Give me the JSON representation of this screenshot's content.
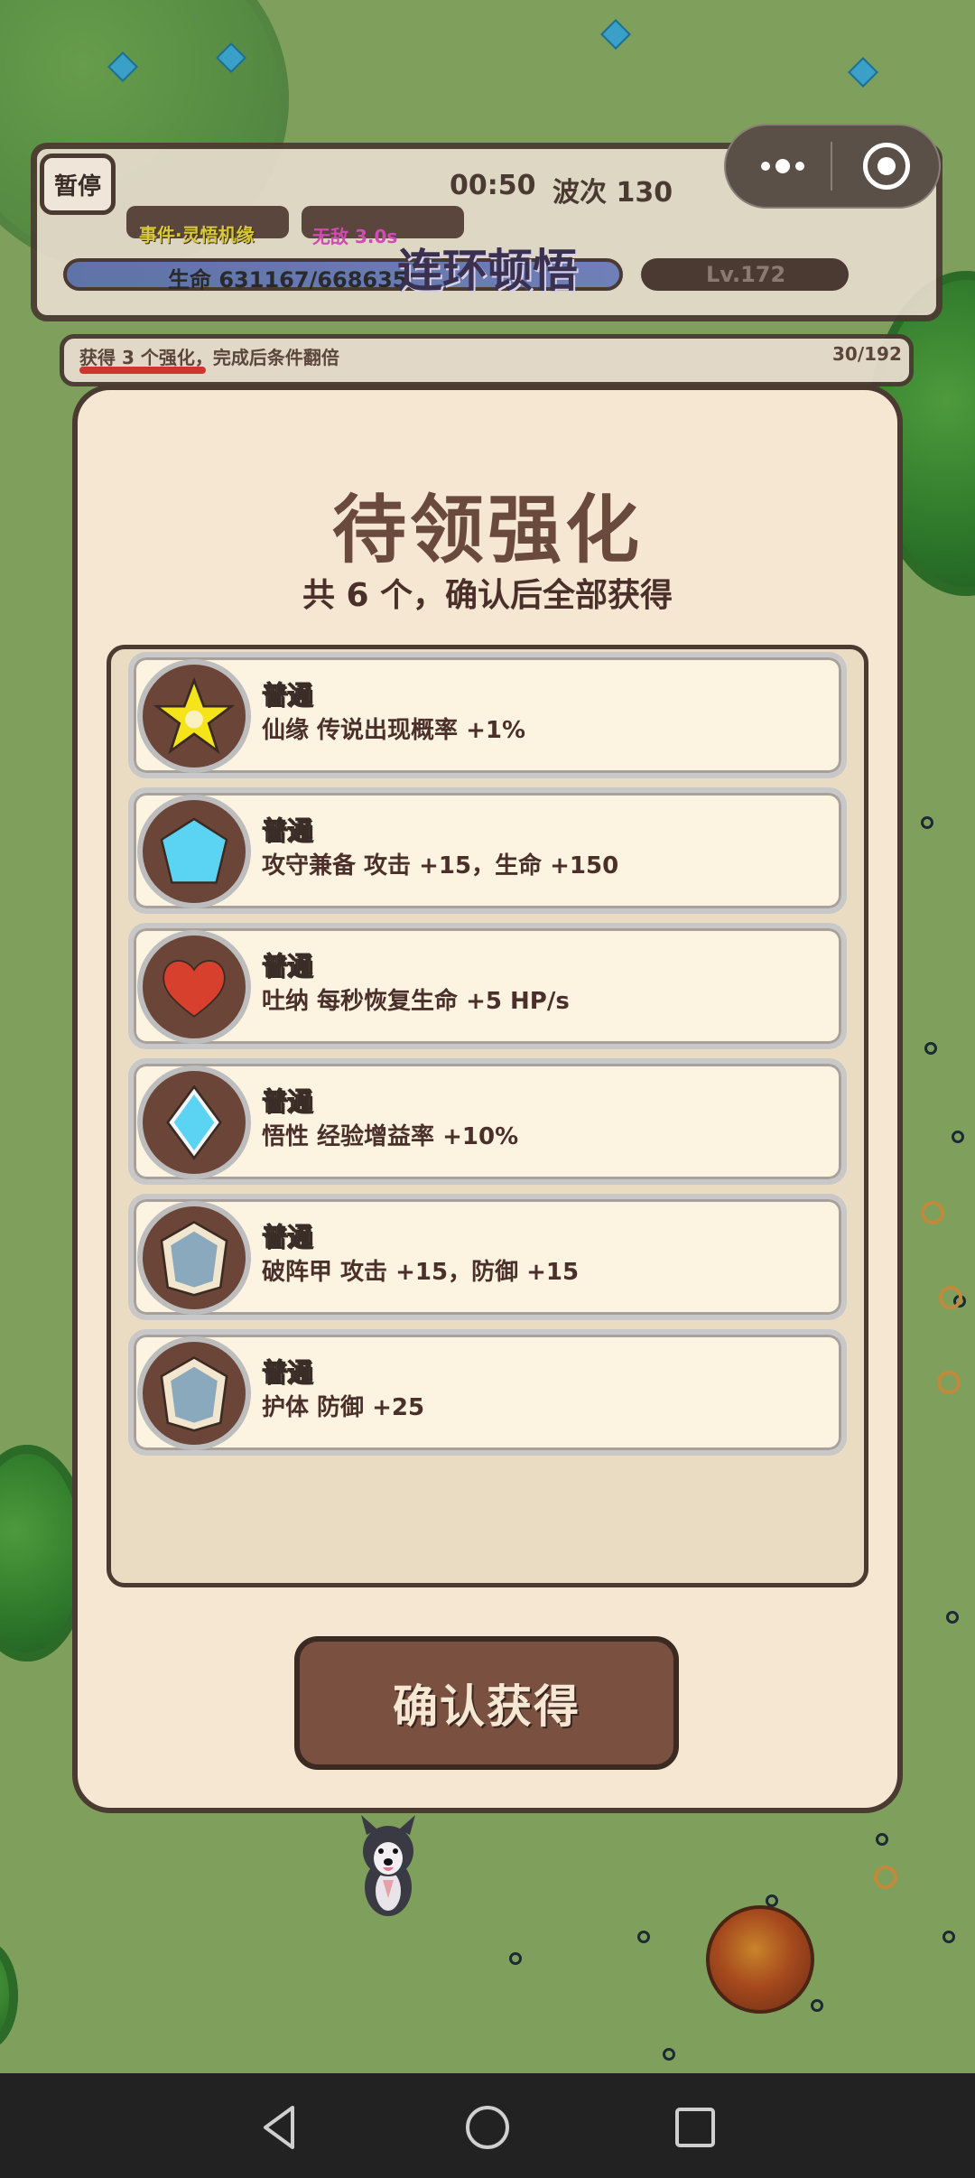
{
  "hud": {
    "pause_label": "暂停",
    "timer": "00:50",
    "wave": "波次 130",
    "event": "事件·灵悟机缘",
    "invincible": "无敌 3.0s",
    "hp": "生命 631167/668635",
    "combo": "连环顿悟",
    "level": "Lv.172"
  },
  "quest": {
    "text": "获得 3 个强化，完成后条件翻倍",
    "count": "30/192"
  },
  "modal": {
    "title": "待领强化",
    "subtitle": "共 6 个，确认后全部获得",
    "confirm_label": "确认获得",
    "rewards": [
      {
        "rarity": "普通",
        "desc": "仙缘  传说出现概率 +1%",
        "icon": "star-icon"
      },
      {
        "rarity": "普通",
        "desc": "攻守兼备  攻击 +15，生命 +150",
        "icon": "crystal-pentagon-icon"
      },
      {
        "rarity": "普通",
        "desc": "吐纳  每秒恢复生命 +5 HP/s",
        "icon": "heart-icon"
      },
      {
        "rarity": "普通",
        "desc": "悟性  经验增益率 +10%",
        "icon": "diamond-icon"
      },
      {
        "rarity": "普通",
        "desc": "破阵甲  攻击 +15，防御 +15",
        "icon": "shield-icon"
      },
      {
        "rarity": "普通",
        "desc": "护体  防御 +25",
        "icon": "shield-icon"
      }
    ]
  },
  "colors": {
    "panel_bg": "#f6e7d3",
    "border": "#4a3a32",
    "button": "#7a5040",
    "grass": "#7fa05c"
  }
}
